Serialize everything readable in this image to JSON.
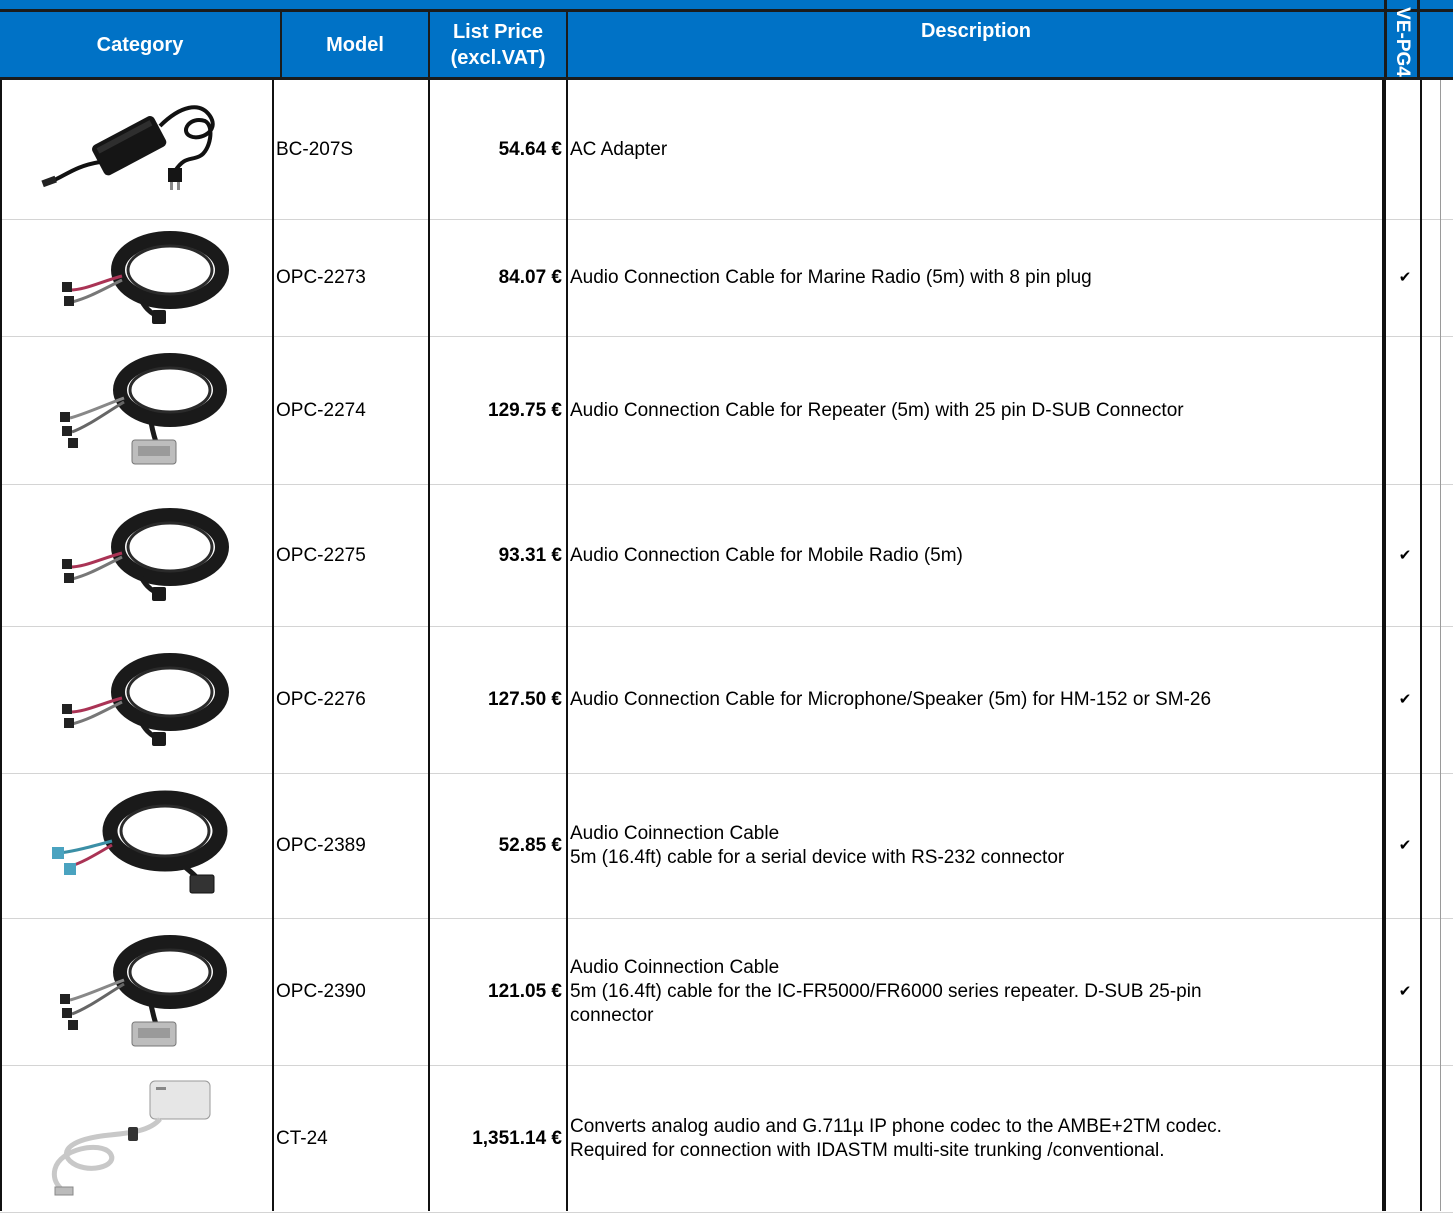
{
  "header": {
    "category": "Category",
    "model": "Model",
    "price_line1": "List Price",
    "price_line2": "(excl.VAT)",
    "description": "Description",
    "vertical_col": "VE-PG4"
  },
  "colors": {
    "header_bg": "#0072c6",
    "header_text": "#ffffff",
    "grid": "#111111"
  },
  "rows": [
    {
      "image": "ac-adapter-image",
      "model": "BC-207S",
      "price": "54.64 €",
      "desc1": "AC Adapter",
      "desc2": "",
      "desc3": "",
      "check": ""
    },
    {
      "image": "cable-image",
      "model": "OPC-2273",
      "price": "84.07 €",
      "desc1": "Audio Connection Cable for Marine Radio (5m) with 8 pin plug",
      "desc2": "",
      "desc3": "",
      "check": "✔"
    },
    {
      "image": "cable-dsub-image",
      "model": "OPC-2274",
      "price": "129.75 €",
      "desc1": "Audio Connection Cable for Repeater (5m) with 25 pin D-SUB Connector",
      "desc2": "",
      "desc3": "",
      "check": ""
    },
    {
      "image": "cable-image",
      "model": "OPC-2275",
      "price": "93.31 €",
      "desc1": "Audio Connection Cable for Mobile Radio (5m)",
      "desc2": "",
      "desc3": "",
      "check": "✔"
    },
    {
      "image": "cable-image",
      "model": "OPC-2276",
      "price": "127.50 €",
      "desc1": "Audio Connection Cable for Microphone/Speaker (5m) for HM-152 or SM-26",
      "desc2": "",
      "desc3": "",
      "check": "✔"
    },
    {
      "image": "cable-serial-image",
      "model": "OPC-2389",
      "price": "52.85 €",
      "desc1": "Audio Coinnection Cable",
      "desc2": "5m (16.4ft) cable for a serial device with RS-232 connector",
      "desc3": "",
      "check": "✔"
    },
    {
      "image": "cable-dsub-image",
      "model": "OPC-2390",
      "price": "121.05 €",
      "desc1": "Audio Coinnection Cable",
      "desc2": "5m (16.4ft) cable for the IC-FR5000/FR6000 series repeater. D-SUB 25-pin",
      "desc3": "connector",
      "check": "✔"
    },
    {
      "image": "converter-box-image",
      "model": "CT-24",
      "price": "1,351.14 €",
      "desc1": "Converts analog audio and G.711µ IP phone codec to the AMBE+2TM codec.",
      "desc2": "Required for connection with IDASTM multi-site trunking /conventional.",
      "desc3": "",
      "check": ""
    }
  ]
}
